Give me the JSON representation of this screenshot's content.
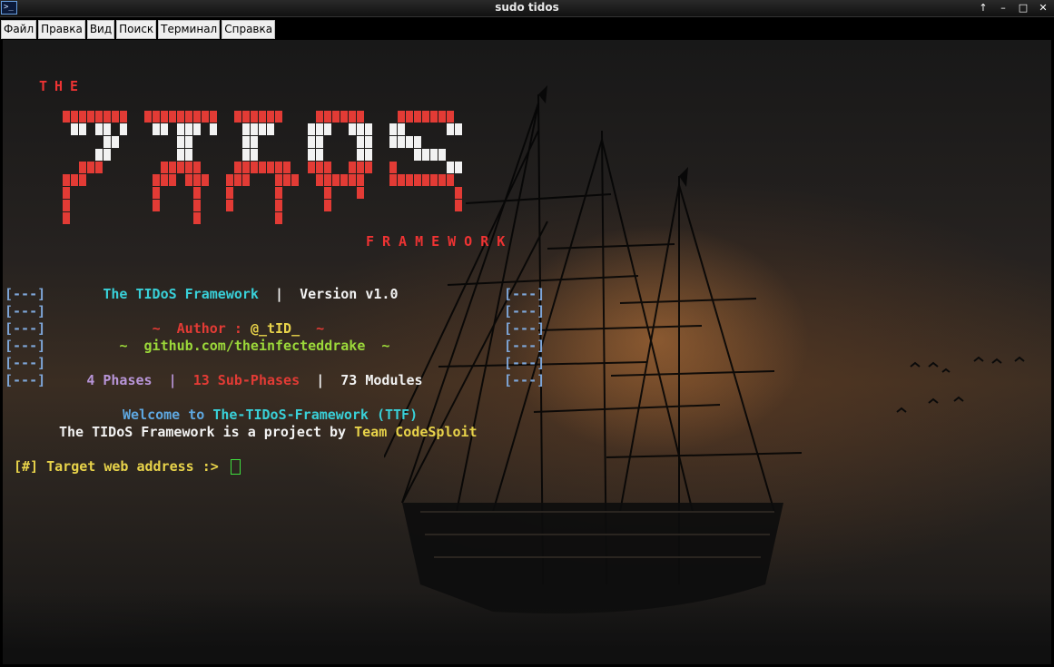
{
  "window": {
    "title": "sudo tidos",
    "icon": "terminal-icon",
    "controls": [
      "↑",
      "–",
      "□",
      "✕"
    ]
  },
  "menubar": {
    "items": [
      "Файл",
      "Правка",
      "Вид",
      "Поиск",
      "Терминал",
      "Справка"
    ]
  },
  "banner": {
    "the": "THE",
    "framework": "FRAMEWORK",
    "bracket_left": "[---]",
    "bracket_right": "[---]",
    "title_name": "The TIDoS Framework",
    "title_sep": "|",
    "version": "Version v1.0",
    "author_prefix": "~  Author : ",
    "author_name": "@_tID_",
    "author_suffix": "  ~",
    "github_prefix": "~  ",
    "github": "github.com/theinfecteddrake",
    "github_suffix": "  ~",
    "phases": "4 Phases",
    "sep": "|",
    "sub_phases": "13 Sub-Phases",
    "modules": "73 Modules"
  },
  "welcome": {
    "prefix": "Welcome to ",
    "name": "The-TIDoS-Framework (TTF)",
    "project_prefix": "The TIDoS Framework is a project by ",
    "team": "Team CodeSploit"
  },
  "prompt": {
    "text": "[#] Target web address :> ",
    "value": ""
  },
  "colors": {
    "logo_red": "#e23b35",
    "logo_white": "#f2f2f2",
    "bracket": "#7ea6d8",
    "cursor": "#3fe03f"
  }
}
